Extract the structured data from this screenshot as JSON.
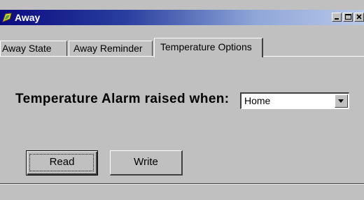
{
  "window": {
    "title": "Away",
    "icon": "app-icon",
    "controls": [
      "minimize-icon",
      "maximize-icon",
      "close-icon"
    ]
  },
  "tabs": [
    {
      "label": "Away State",
      "selected": false
    },
    {
      "label": "Away Reminder",
      "selected": false
    },
    {
      "label": "Temperature Options",
      "selected": true
    }
  ],
  "form": {
    "alarm_label": "Temperature Alarm raised when:",
    "alarm_select_value": "Home"
  },
  "buttons": {
    "read": "Read",
    "write": "Write"
  },
  "colors": {
    "title_bar_start": "#0a0a80",
    "title_bar_end": "#b8c8e8",
    "face": "#c0c0c0"
  }
}
